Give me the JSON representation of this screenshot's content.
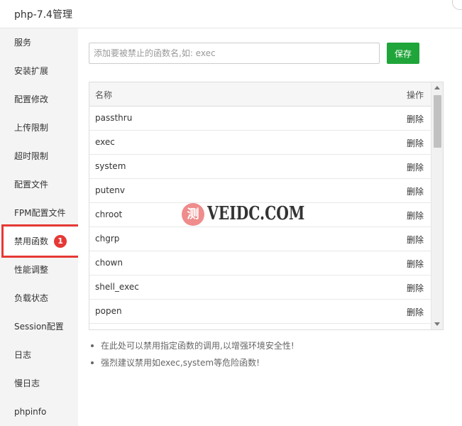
{
  "window": {
    "title": "php-7.4管理"
  },
  "sidebar": {
    "items": [
      {
        "label": "服务"
      },
      {
        "label": "安装扩展"
      },
      {
        "label": "配置修改"
      },
      {
        "label": "上传限制"
      },
      {
        "label": "超时限制"
      },
      {
        "label": "配置文件"
      },
      {
        "label": "FPM配置文件"
      },
      {
        "label": "禁用函数",
        "badge": "1"
      },
      {
        "label": "性能调整"
      },
      {
        "label": "负载状态"
      },
      {
        "label": "Session配置"
      },
      {
        "label": "日志"
      },
      {
        "label": "慢日志"
      },
      {
        "label": "phpinfo"
      }
    ],
    "active_index": 7,
    "highlight_color": "#e53935"
  },
  "form": {
    "input_placeholder": "添加要被禁止的函数名,如: exec",
    "input_value": "",
    "save_label": "保存",
    "save_color": "#20a53a"
  },
  "table": {
    "headers": {
      "name": "名称",
      "action": "操作"
    },
    "rows": [
      {
        "name": "passthru",
        "action": "删除"
      },
      {
        "name": "exec",
        "action": "删除"
      },
      {
        "name": "system",
        "action": "删除"
      },
      {
        "name": "putenv",
        "action": "删除"
      },
      {
        "name": "chroot",
        "action": "删除"
      },
      {
        "name": "chgrp",
        "action": "删除"
      },
      {
        "name": "chown",
        "action": "删除"
      },
      {
        "name": "shell_exec",
        "action": "删除"
      },
      {
        "name": "popen",
        "action": "删除"
      }
    ]
  },
  "tips": [
    "在此处可以禁用指定函数的调用,以增强环境安全性!",
    "强烈建议禁用如exec,system等危险函数!"
  ],
  "watermark": {
    "glyph": "测",
    "text": "VEIDC.COM"
  }
}
